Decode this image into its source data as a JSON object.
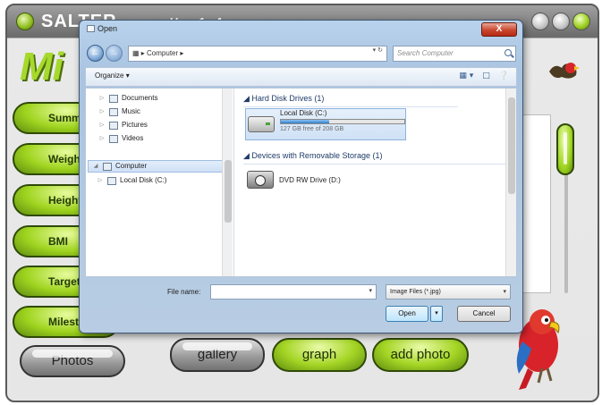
{
  "app": {
    "brand": "SALTER",
    "user_label": "User 1 - Anna",
    "logo_text": "Mi",
    "side_buttons": [
      "Summary",
      "Weight",
      "Height",
      "BMI",
      "Targets",
      "Milestones"
    ],
    "photos_label": "Photos",
    "bottom_buttons": {
      "gallery": "gallery",
      "graph": "graph",
      "add_photo": "add photo"
    },
    "accent_green": "#9fd41f"
  },
  "dialog": {
    "title": "Open",
    "close_label": "X",
    "address_text": "Computer",
    "search_placeholder": "Search Computer",
    "organize_label": "Organize",
    "nav_items": [
      {
        "label": "Documents",
        "icon": "documents-icon"
      },
      {
        "label": "Music",
        "icon": "music-icon"
      },
      {
        "label": "Pictures",
        "icon": "pictures-icon"
      },
      {
        "label": "Videos",
        "icon": "videos-icon"
      },
      {
        "label": "Computer",
        "icon": "computer-icon"
      },
      {
        "label": "Local Disk (C:)",
        "icon": "local-disk-icon"
      }
    ],
    "groups": {
      "hard_disk_header": "Hard Disk Drives (1)",
      "removable_header": "Devices with Removable Storage (1)"
    },
    "local_disk": {
      "name": "Local Disk (C:)",
      "free_text": "127 GB free of 208 GB",
      "used_fraction": 0.39
    },
    "dvd_drive": {
      "name": "DVD RW Drive (D:)"
    },
    "filename_label": "File name:",
    "filename_value": "",
    "filter_value": "Image Files (*.jpg)",
    "open_label": "Open",
    "cancel_label": "Cancel"
  }
}
